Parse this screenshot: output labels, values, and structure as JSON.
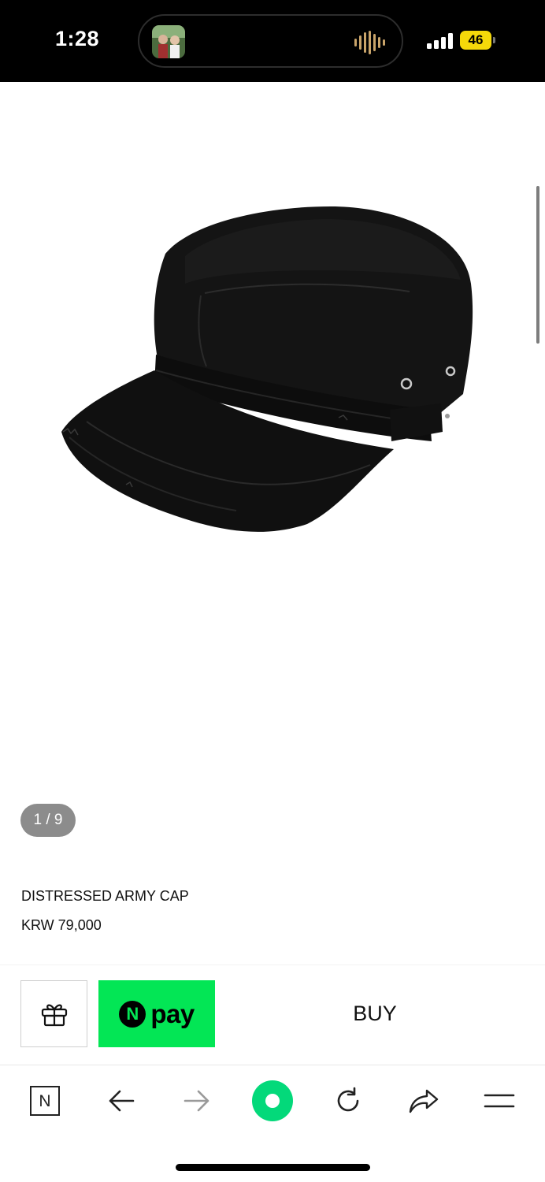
{
  "status_bar": {
    "time": "1:28",
    "battery": "46"
  },
  "gallery": {
    "counter": "1 / 9"
  },
  "product": {
    "name": "DISTRESSED ARMY CAP",
    "price": "KRW 79,000"
  },
  "purchase": {
    "npay_badge": "N",
    "npay_label": "pay",
    "buy_label": "BUY"
  },
  "browser_toolbar": {
    "home_glyph": "N"
  },
  "icons": {
    "gift": "gift-icon",
    "back": "arrow-left-icon",
    "forward": "arrow-right-icon",
    "green_dot": "green-dot-icon",
    "reload": "reload-icon",
    "share": "share-icon",
    "menu": "menu-icon"
  },
  "colors": {
    "npay_green": "#03e655",
    "counter_gray": "#8c8c8c",
    "battery_yellow": "#f5d90a"
  }
}
